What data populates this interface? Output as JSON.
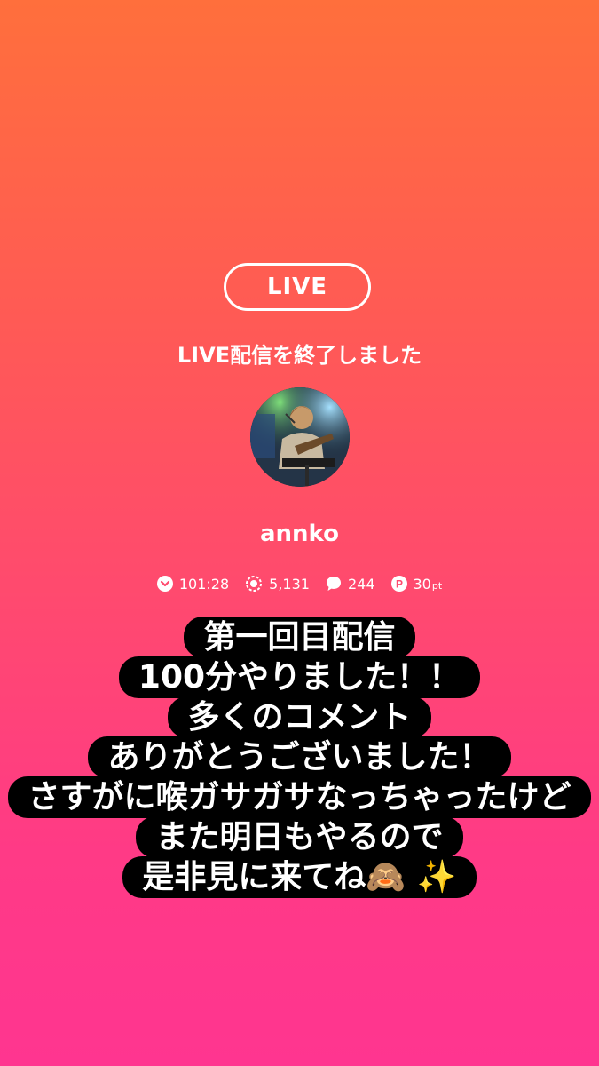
{
  "live_badge": "LIVE",
  "ended_message": "LIVE配信を終了しました",
  "username": "annko",
  "stats": {
    "duration": "101:28",
    "viewers": "5,131",
    "comments": "244",
    "points": "30",
    "points_unit": "pt"
  },
  "caption_lines": [
    "第一回目配信",
    "100分やりました！！",
    "多くのコメント",
    "ありがとうございました！",
    "さすがに喉ガサガサなっちゃったけど",
    "また明日もやるので",
    "是非見に来てね🙈 ✨"
  ],
  "colors": {
    "gradient_top": "#ff6f3c",
    "gradient_bottom": "#ff3590",
    "caption_bg": "#000000"
  },
  "icons": [
    "clock-icon",
    "viewers-icon",
    "comment-icon",
    "points-icon",
    "see-no-evil-monkey-emoji",
    "sparkles-emoji"
  ]
}
